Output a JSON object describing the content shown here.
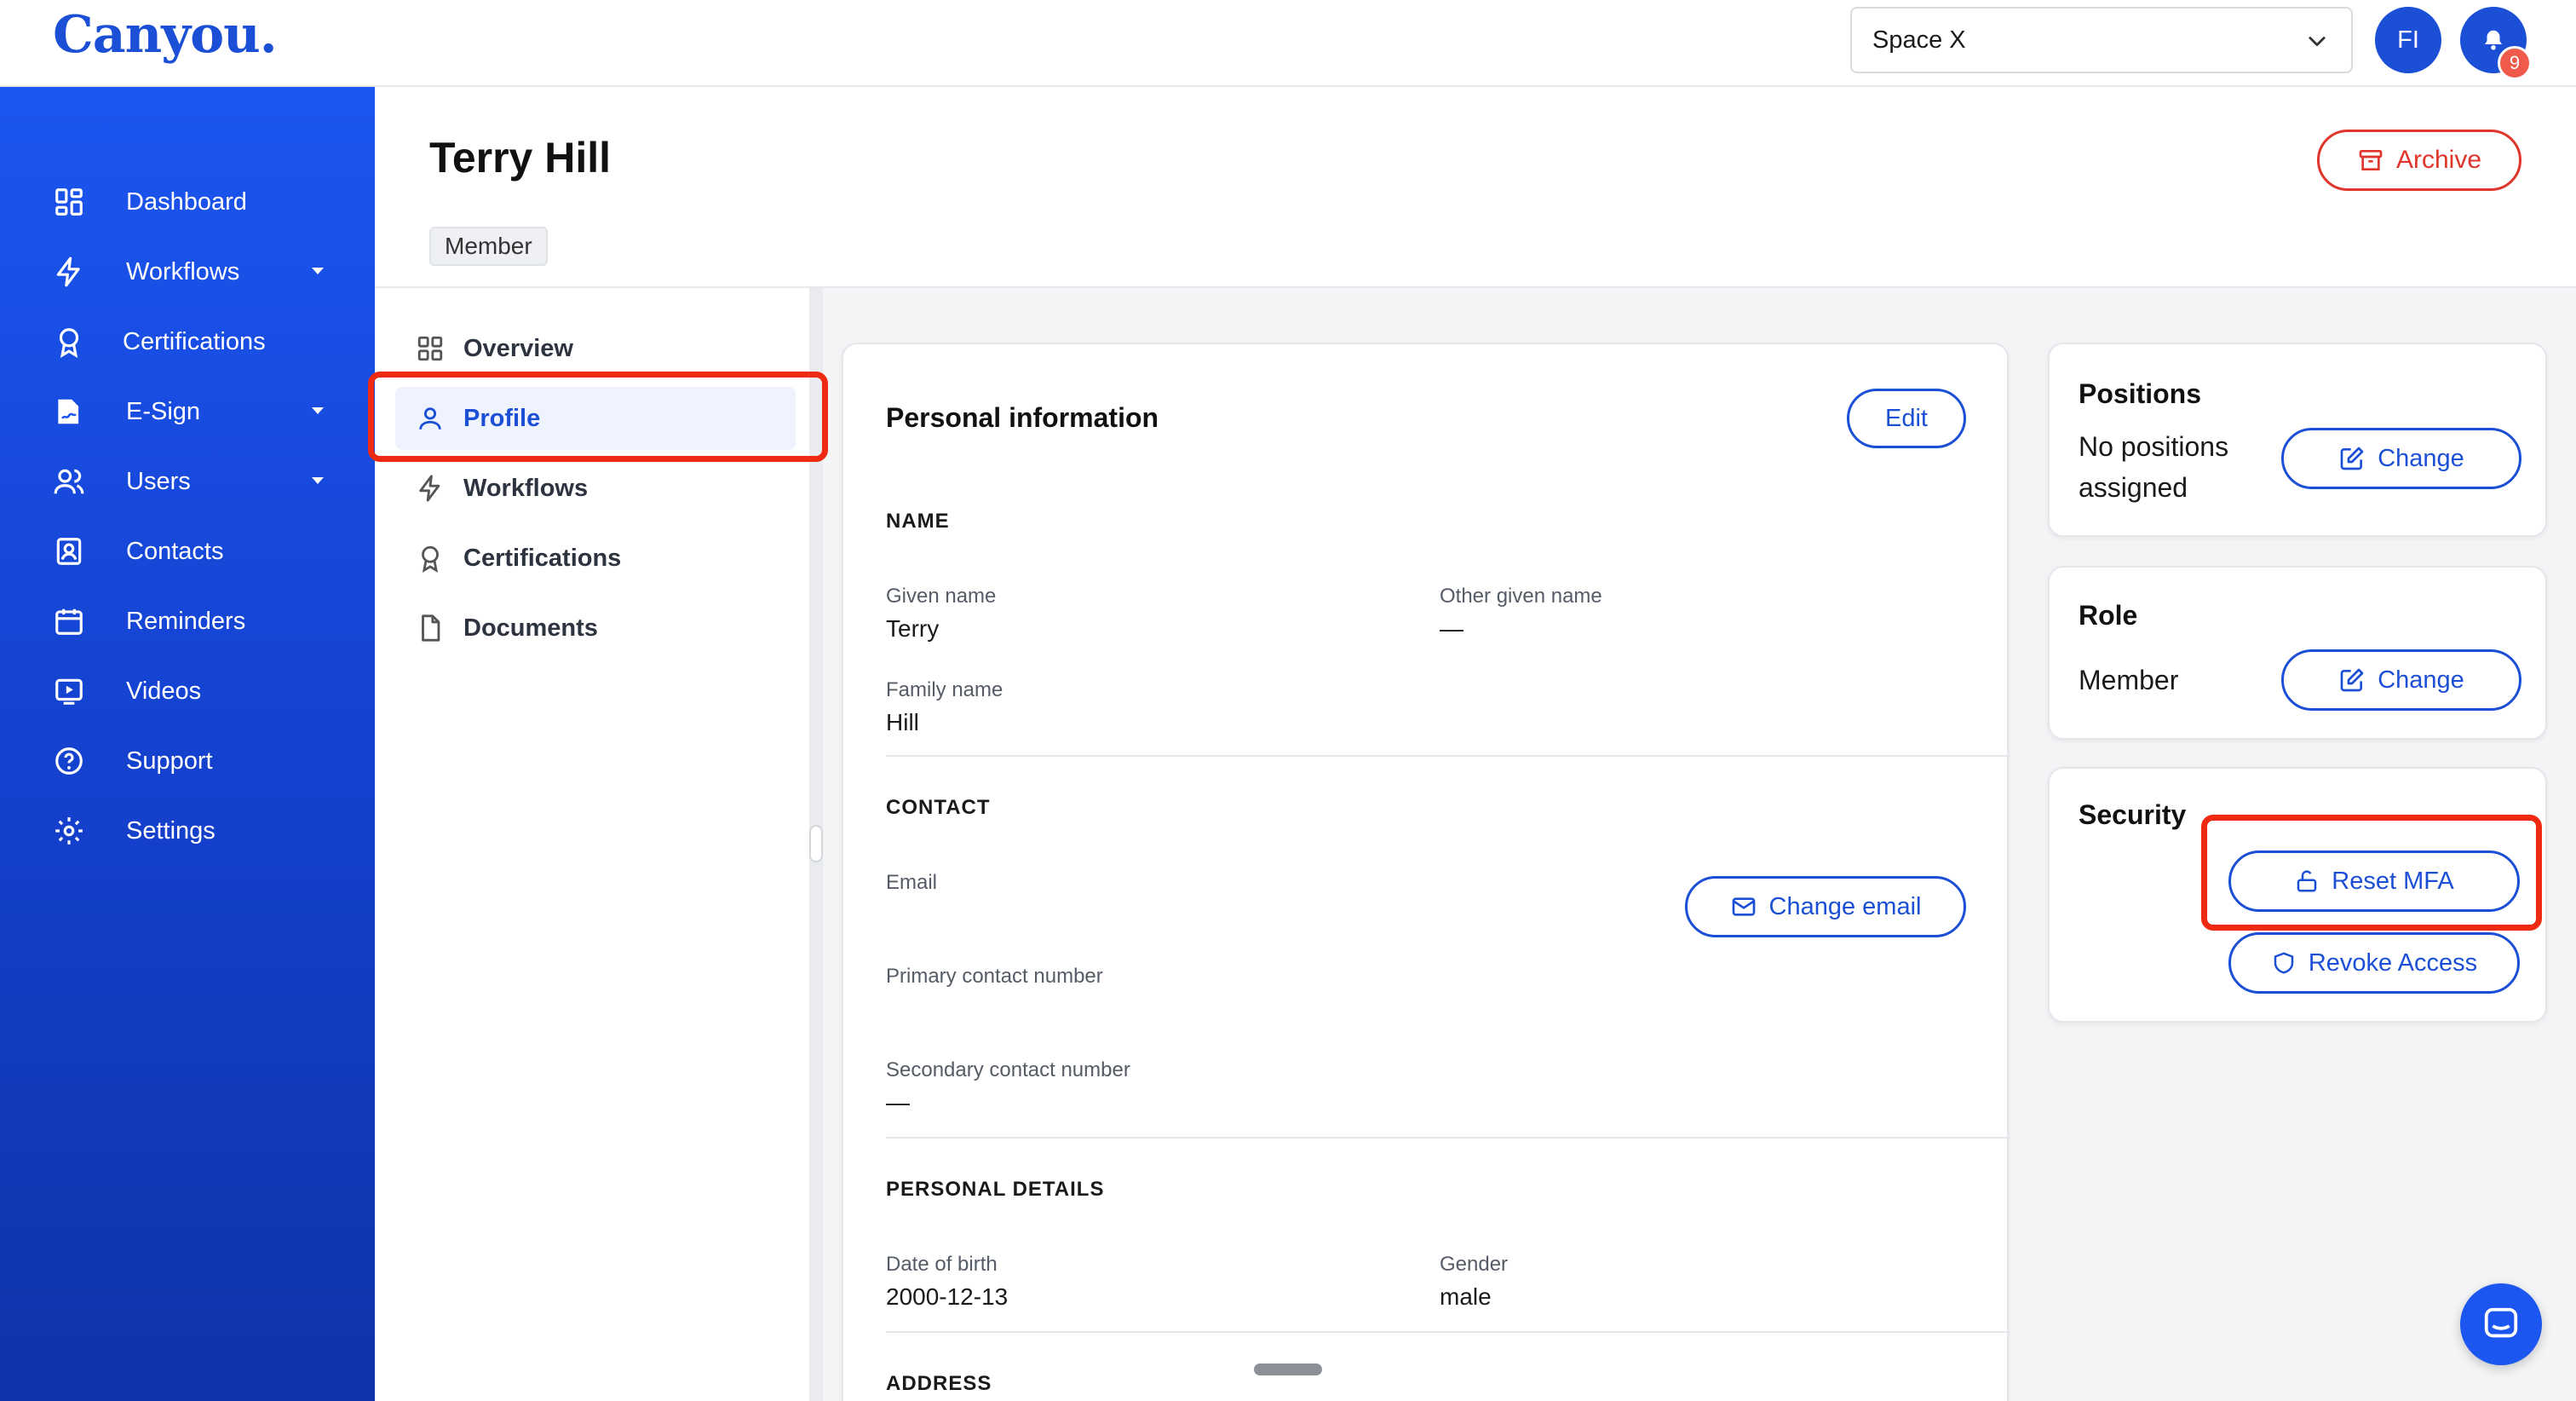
{
  "brand": {
    "logo_text": "Canyou."
  },
  "header": {
    "workspace": "Space X",
    "avatar_initials": "FI",
    "notification_count": "9"
  },
  "sidebar": {
    "items": [
      {
        "label": "Dashboard",
        "icon": "grid-icon"
      },
      {
        "label": "Workflows",
        "icon": "bolt-icon"
      },
      {
        "label": "Certifications",
        "icon": "award-icon"
      },
      {
        "label": "E-Sign",
        "icon": "sign-icon"
      },
      {
        "label": "Users",
        "icon": "users-icon"
      },
      {
        "label": "Contacts",
        "icon": "contact-icon"
      },
      {
        "label": "Reminders",
        "icon": "calendar-icon"
      },
      {
        "label": "Videos",
        "icon": "video-icon"
      },
      {
        "label": "Support",
        "icon": "help-icon"
      },
      {
        "label": "Settings",
        "icon": "gear-icon"
      }
    ]
  },
  "page": {
    "title": "Terry Hill",
    "role_chip": "Member",
    "archive_label": "Archive"
  },
  "subnav": {
    "items": [
      {
        "label": "Overview"
      },
      {
        "label": "Profile"
      },
      {
        "label": "Workflows"
      },
      {
        "label": "Certifications"
      },
      {
        "label": "Documents"
      }
    ],
    "active": "Profile"
  },
  "personal_info": {
    "title": "Personal information",
    "edit_label": "Edit",
    "name_section": "NAME",
    "given_name_label": "Given name",
    "given_name": "Terry",
    "other_given_name_label": "Other given name",
    "other_given_name": "—",
    "family_name_label": "Family name",
    "family_name": "Hill",
    "contact_section": "CONTACT",
    "email_label": "Email",
    "change_email_label": "Change email",
    "primary_contact_label": "Primary contact number",
    "secondary_contact_label": "Secondary contact number",
    "secondary_contact": "—",
    "details_section": "PERSONAL DETAILS",
    "dob_label": "Date of birth",
    "dob": "2000-12-13",
    "gender_label": "Gender",
    "gender": "male",
    "address_section": "ADDRESS"
  },
  "positions": {
    "title": "Positions",
    "text_line1": "No positions",
    "text_line2": "assigned",
    "change_label": "Change"
  },
  "role": {
    "title": "Role",
    "value": "Member",
    "change_label": "Change"
  },
  "security": {
    "title": "Security",
    "reset_mfa_label": "Reset MFA",
    "revoke_access_label": "Revoke Access"
  },
  "colors": {
    "brand_blue": "#1b4fd6",
    "danger_red": "#e0352b",
    "highlight_red": "#ee2a12"
  }
}
